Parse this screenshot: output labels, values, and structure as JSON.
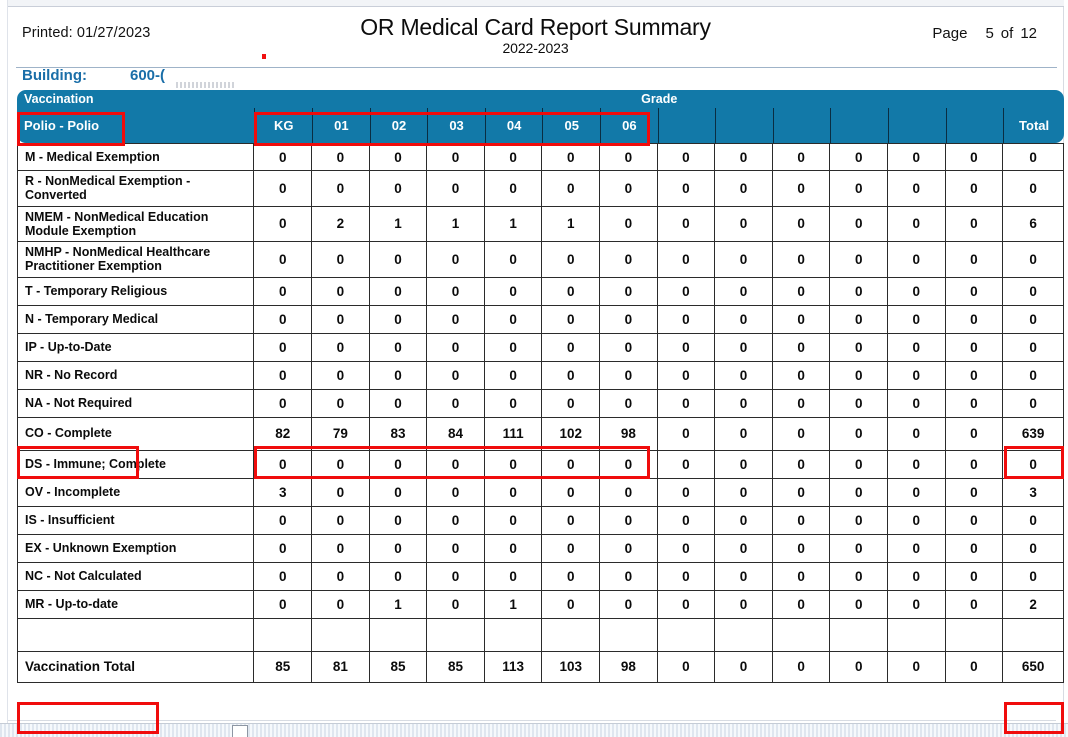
{
  "header": {
    "printed_label": "Printed:",
    "printed_date": "01/27/2023",
    "printed_full": "Printed: 01/27/2023",
    "title": "OR Medical Card Report Summary",
    "subtitle": "2022-2023",
    "page_label": "Page",
    "page_number": "5",
    "page_of": "of",
    "page_total": "12"
  },
  "building": {
    "label": "Building:",
    "value": "600-("
  },
  "table": {
    "band_left_label": "Vaccination",
    "band_grade_label": "Grade",
    "vaccination_name": "Polio - Polio",
    "total_label": "Total",
    "columns": [
      "KG",
      "01",
      "02",
      "03",
      "04",
      "05",
      "06",
      "",
      "",
      "",
      "",
      "",
      "",
      ""
    ],
    "rows": [
      {
        "label": "M - Medical Exemption",
        "values": [
          "0",
          "0",
          "0",
          "0",
          "0",
          "0",
          "0",
          "0",
          "0",
          "0",
          "0",
          "0",
          "0"
        ],
        "total": "0"
      },
      {
        "label": "R - NonMedical Exemption - Converted",
        "values": [
          "0",
          "0",
          "0",
          "0",
          "0",
          "0",
          "0",
          "0",
          "0",
          "0",
          "0",
          "0",
          "0"
        ],
        "total": "0"
      },
      {
        "label": "NMEM - NonMedical Education Module Exemption",
        "values": [
          "0",
          "2",
          "1",
          "1",
          "1",
          "1",
          "0",
          "0",
          "0",
          "0",
          "0",
          "0",
          "0"
        ],
        "total": "6"
      },
      {
        "label": "NMHP - NonMedical Healthcare Practitioner Exemption",
        "values": [
          "0",
          "0",
          "0",
          "0",
          "0",
          "0",
          "0",
          "0",
          "0",
          "0",
          "0",
          "0",
          "0"
        ],
        "total": "0"
      },
      {
        "label": "T - Temporary Religious",
        "values": [
          "0",
          "0",
          "0",
          "0",
          "0",
          "0",
          "0",
          "0",
          "0",
          "0",
          "0",
          "0",
          "0"
        ],
        "total": "0"
      },
      {
        "label": "N - Temporary Medical",
        "values": [
          "0",
          "0",
          "0",
          "0",
          "0",
          "0",
          "0",
          "0",
          "0",
          "0",
          "0",
          "0",
          "0"
        ],
        "total": "0"
      },
      {
        "label": "IP - Up-to-Date",
        "values": [
          "0",
          "0",
          "0",
          "0",
          "0",
          "0",
          "0",
          "0",
          "0",
          "0",
          "0",
          "0",
          "0"
        ],
        "total": "0"
      },
      {
        "label": "NR - No Record",
        "values": [
          "0",
          "0",
          "0",
          "0",
          "0",
          "0",
          "0",
          "0",
          "0",
          "0",
          "0",
          "0",
          "0"
        ],
        "total": "0"
      },
      {
        "label": "NA - Not Required",
        "values": [
          "0",
          "0",
          "0",
          "0",
          "0",
          "0",
          "0",
          "0",
          "0",
          "0",
          "0",
          "0",
          "0"
        ],
        "total": "0"
      },
      {
        "label": "CO - Complete",
        "values": [
          "82",
          "79",
          "83",
          "84",
          "111",
          "102",
          "98",
          "0",
          "0",
          "0",
          "0",
          "0",
          "0"
        ],
        "total": "639"
      },
      {
        "label": "DS - Immune; Complete",
        "values": [
          "0",
          "0",
          "0",
          "0",
          "0",
          "0",
          "0",
          "0",
          "0",
          "0",
          "0",
          "0",
          "0"
        ],
        "total": "0"
      },
      {
        "label": "OV - Incomplete",
        "values": [
          "3",
          "0",
          "0",
          "0",
          "0",
          "0",
          "0",
          "0",
          "0",
          "0",
          "0",
          "0",
          "0"
        ],
        "total": "3"
      },
      {
        "label": "IS - Insufficient",
        "values": [
          "0",
          "0",
          "0",
          "0",
          "0",
          "0",
          "0",
          "0",
          "0",
          "0",
          "0",
          "0",
          "0"
        ],
        "total": "0"
      },
      {
        "label": "EX - Unknown Exemption",
        "values": [
          "0",
          "0",
          "0",
          "0",
          "0",
          "0",
          "0",
          "0",
          "0",
          "0",
          "0",
          "0",
          "0"
        ],
        "total": "0"
      },
      {
        "label": "NC - Not Calculated",
        "values": [
          "0",
          "0",
          "0",
          "0",
          "0",
          "0",
          "0",
          "0",
          "0",
          "0",
          "0",
          "0",
          "0"
        ],
        "total": "0"
      },
      {
        "label": "MR - Up-to-date",
        "values": [
          "0",
          "0",
          "1",
          "0",
          "1",
          "0",
          "0",
          "0",
          "0",
          "0",
          "0",
          "0",
          "0"
        ],
        "total": "2"
      },
      {
        "label": "",
        "values": [
          "",
          "",
          "",
          "",
          "",
          "",
          "",
          "",
          "",
          "",
          "",
          "",
          ""
        ],
        "total": ""
      }
    ],
    "footer": {
      "label": "Vaccination Total",
      "values": [
        "85",
        "81",
        "85",
        "85",
        "113",
        "103",
        "98",
        "0",
        "0",
        "0",
        "0",
        "0",
        "0"
      ],
      "total": "650"
    }
  },
  "colors": {
    "header_band": "#1279a8",
    "building_text": "#1a6ea8",
    "annotation": "#f00c0c",
    "grid_line": "#2b2b2b"
  }
}
